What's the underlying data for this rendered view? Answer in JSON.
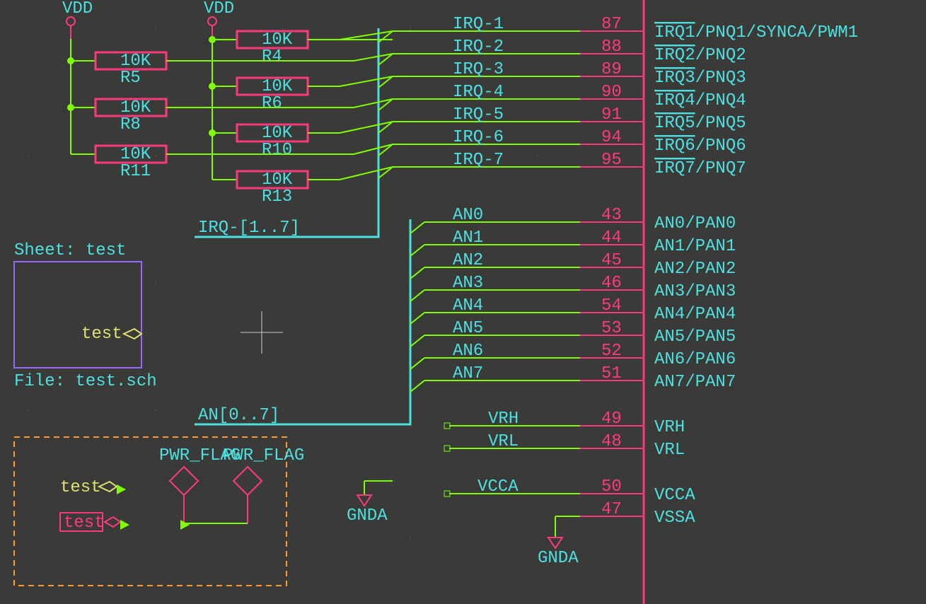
{
  "power": {
    "vdd1": "VDD",
    "vdd2": "VDD"
  },
  "resistors": {
    "r5": {
      "val": "10K",
      "ref": "R5"
    },
    "r8": {
      "val": "10K",
      "ref": "R8"
    },
    "r11": {
      "val": "10K",
      "ref": "R11"
    },
    "r4": {
      "val": "10K",
      "ref": "R4"
    },
    "r6": {
      "val": "10K",
      "ref": "R6"
    },
    "r10": {
      "val": "10K",
      "ref": "R10"
    },
    "r13": {
      "val": "10K",
      "ref": "R13"
    }
  },
  "bus_labels": {
    "irq": "IRQ-[1..7]",
    "an": "AN[0..7]"
  },
  "net_labels": {
    "irq1": "IRQ-1",
    "irq2": "IRQ-2",
    "irq3": "IRQ-3",
    "irq4": "IRQ-4",
    "irq5": "IRQ-5",
    "irq6": "IRQ-6",
    "irq7": "IRQ-7",
    "an0": "AN0",
    "an1": "AN1",
    "an2": "AN2",
    "an3": "AN3",
    "an4": "AN4",
    "an5": "AN5",
    "an6": "AN6",
    "an7": "AN7",
    "vrh": "VRH",
    "vrl": "VRL",
    "vcca": "VCCA"
  },
  "pins": {
    "irq1": {
      "num": "87",
      "name_ov": "IRQ1",
      "name_rest": "/PNQ1/SYNCA/PWM1"
    },
    "irq2": {
      "num": "88",
      "name_ov": "IRQ2",
      "name_rest": "/PNQ2"
    },
    "irq3": {
      "num": "89",
      "name_ov": "IRQ3",
      "name_rest": "/PNQ3"
    },
    "irq4": {
      "num": "90",
      "name_ov": "IRQ4",
      "name_rest": "/PNQ4"
    },
    "irq5": {
      "num": "91",
      "name_ov": "IRQ5",
      "name_rest": "/PNQ5"
    },
    "irq6": {
      "num": "94",
      "name_ov": "IRQ6",
      "name_rest": "/PNQ6"
    },
    "irq7": {
      "num": "95",
      "name_ov": "IRQ7",
      "name_rest": "/PNQ7"
    },
    "an0": {
      "num": "43",
      "name": "AN0/PAN0"
    },
    "an1": {
      "num": "44",
      "name": "AN1/PAN1"
    },
    "an2": {
      "num": "45",
      "name": "AN2/PAN2"
    },
    "an3": {
      "num": "46",
      "name": "AN3/PAN3"
    },
    "an4": {
      "num": "54",
      "name": "AN4/PAN4"
    },
    "an5": {
      "num": "53",
      "name": "AN5/PAN5"
    },
    "an6": {
      "num": "52",
      "name": "AN6/PAN6"
    },
    "an7": {
      "num": "51",
      "name": "AN7/PAN7"
    },
    "vrh": {
      "num": "49",
      "name": "VRH"
    },
    "vrl": {
      "num": "48",
      "name": "VRL"
    },
    "vcca": {
      "num": "50",
      "name": "VCCA"
    },
    "vssa": {
      "num": "47",
      "name": "VSSA"
    }
  },
  "sheet": {
    "title": "Sheet: test",
    "port": "test",
    "file": "File: test.sch"
  },
  "annotation_box": {
    "label1": "test",
    "label2": "test",
    "pwr1": "PWR_FLAG",
    "pwr2": "PWR_FLAG"
  },
  "grounds": {
    "g1": "GNDA",
    "g2": "GNDA"
  }
}
